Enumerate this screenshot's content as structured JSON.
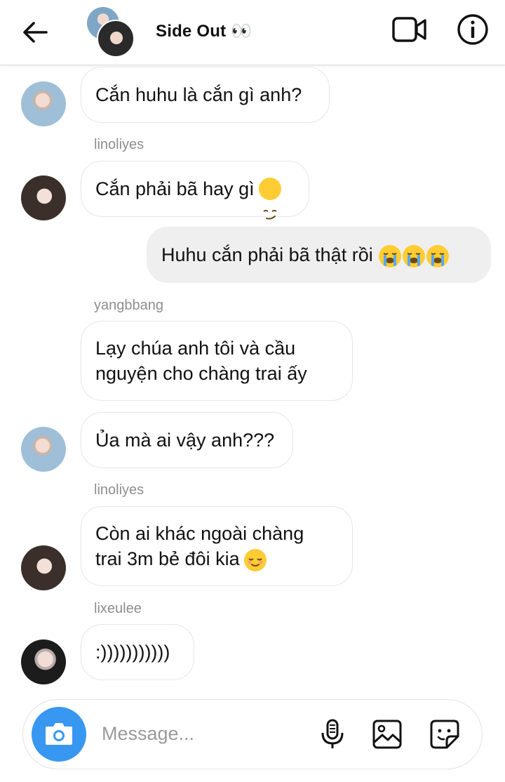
{
  "header": {
    "title": "Side Out 👀",
    "back_icon": "arrow-left-icon",
    "video_icon": "video-camera-icon",
    "info_icon": "info-circle-icon"
  },
  "messages": [
    {
      "text": "Cắn huhu là cắn gì anh?",
      "direction": "in",
      "avatar": "blue"
    },
    {
      "sender": "linoliyes",
      "text": "Cắn phải bã hay gì",
      "emoji": "smirking-face",
      "direction": "in",
      "avatar": "dark"
    },
    {
      "text": "Huhu cắn phải bã thật rồi",
      "emoji": "crying-face x3",
      "direction": "out"
    },
    {
      "sender": "yangbbang",
      "text": "Lạy chúa anh tôi và cầu\nnguyện cho chàng trai ấy",
      "direction": "in"
    },
    {
      "text": "Ủa mà ai vậy anh???",
      "direction": "in",
      "avatar": "blue"
    },
    {
      "sender": "linoliyes",
      "text": "Còn ai khác ngoài chàng\ntrai 3m bẻ đôi kia",
      "emoji": "relieved-face",
      "direction": "in",
      "avatar": "dark"
    },
    {
      "sender": "lixeulee",
      "text": ":)))))))))))",
      "direction": "in",
      "avatar": "dark2"
    }
  ],
  "composer": {
    "placeholder": "Message...",
    "camera_icon": "camera-icon",
    "mic_icon": "microphone-icon",
    "gallery_icon": "image-gallery-icon",
    "sticker_icon": "sticker-icon"
  },
  "colors": {
    "accent": "#3897f0",
    "outgoing_bubble": "#efefef",
    "bubble_border": "#e6e6e6",
    "sender_text": "#8e8e8e"
  }
}
